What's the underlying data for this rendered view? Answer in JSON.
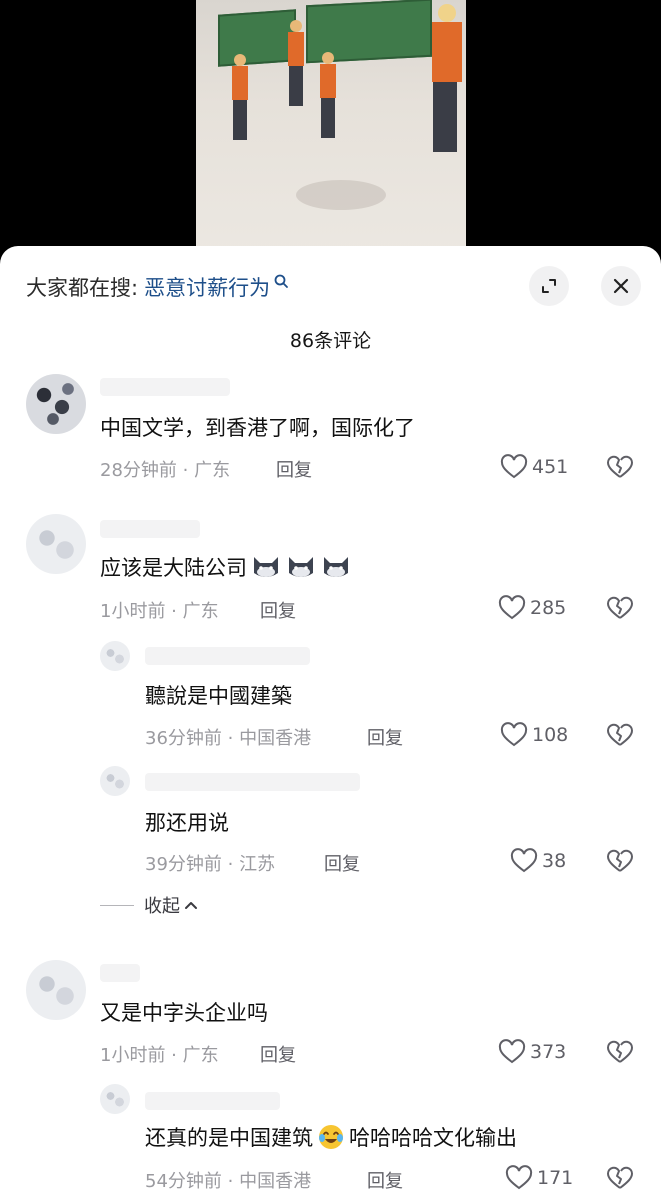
{
  "search": {
    "prefix": "大家都在搜:",
    "term": "恶意讨薪行为"
  },
  "icons": {
    "expand": "expand-icon",
    "close": "close-icon",
    "like": "heart-outline-icon",
    "dislike": "broken-heart-icon"
  },
  "comment_count": "86条评论",
  "comments": [
    {
      "text": "中国文学，到香港了啊，国际化了",
      "time_location": "28分钟前 · 广东",
      "reply_label": "回复",
      "likes": "451"
    },
    {
      "text": "应该是大陆公司",
      "time_location": "1小时前 · 广东",
      "reply_label": "回复",
      "likes": "285"
    },
    {
      "text": "聽說是中國建築",
      "time_location": "36分钟前 · 中国香港",
      "reply_label": "回复",
      "likes": "108"
    },
    {
      "text": "那还用说",
      "time_location": "39分钟前 · 江苏",
      "reply_label": "回复",
      "likes": "38"
    },
    {
      "text": "又是中字头企业吗",
      "time_location": "1小时前 · 广东",
      "reply_label": "回复",
      "likes": "373"
    },
    {
      "text_before": "还真的是中国建筑",
      "text_after": "哈哈哈哈文化输出",
      "time_location": "54分钟前 · 中国香港",
      "reply_label": "回复",
      "likes": "171"
    }
  ],
  "collapse_label": "收起",
  "colors": {
    "link": "#1e4f8a",
    "meta": "#9a9a9f",
    "sheet": "#ffffff"
  }
}
